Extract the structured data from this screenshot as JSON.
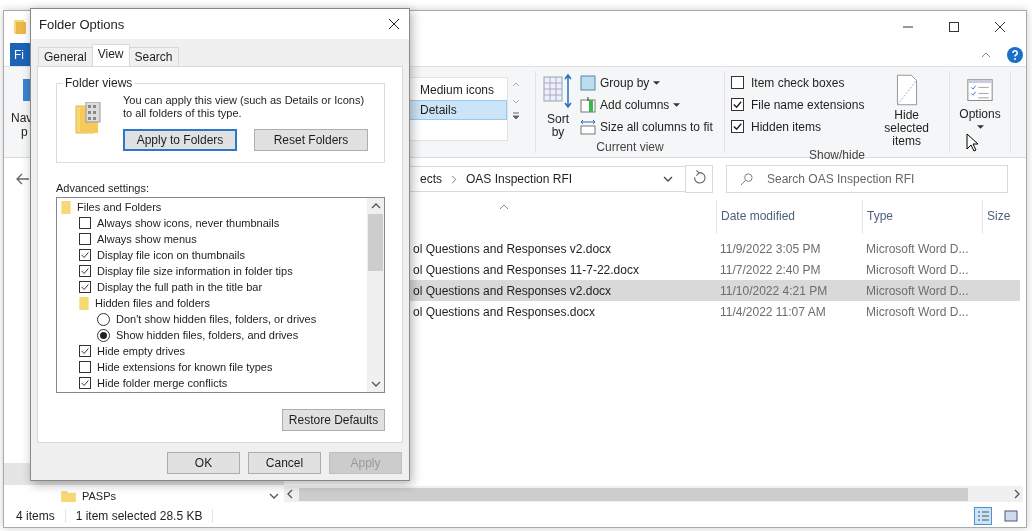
{
  "explorer": {
    "file_tab": "Fi",
    "nav_pane_button": [
      "Nav",
      "p"
    ],
    "layout_options": [
      {
        "label": "Medium icons",
        "selected": false
      },
      {
        "label": "Details",
        "selected": true
      }
    ],
    "current_view": {
      "sort_by": "Sort by",
      "group_by": "Group by",
      "add_columns": "Add columns",
      "size_columns": "Size all columns to fit",
      "group_label": "Current view"
    },
    "show_hide": {
      "checkboxes": [
        {
          "label": "Item check boxes",
          "checked": false
        },
        {
          "label": "File name extensions",
          "checked": true
        },
        {
          "label": "Hidden items",
          "checked": true
        }
      ],
      "hide_selected": "Hide selected items",
      "group_label": "Show/hide"
    },
    "options_button": "Options",
    "address": {
      "path_tail": "ects",
      "current": "OAS Inspection RFI"
    },
    "search": {
      "placeholder": "Search OAS Inspection RFI"
    },
    "columns": [
      "Date modified",
      "Type",
      "Size"
    ],
    "files": [
      {
        "name": "ol Questions and Responses v2.docx",
        "date": "11/9/2022 3:05 PM",
        "type": "Microsoft Word D...",
        "selected": false
      },
      {
        "name": "ol Questions and Responses 11-7-22.docx",
        "date": "11/7/2022 2:40 PM",
        "type": "Microsoft Word D...",
        "selected": false
      },
      {
        "name": "ol Questions and Responses v2.docx",
        "date": "11/10/2022 4:21 PM",
        "type": "Microsoft Word D...",
        "selected": true
      },
      {
        "name": "ol Questions and Responses.docx",
        "date": "11/4/2022 11:07 AM",
        "type": "Microsoft Word D...",
        "selected": false
      }
    ],
    "nav_folder": "PASPs",
    "status": {
      "count": "4 items",
      "selection": "1 item selected  28.5 KB"
    }
  },
  "dialog": {
    "title": "Folder Options",
    "tabs": [
      {
        "label": "General",
        "selected": false
      },
      {
        "label": "View",
        "selected": true
      },
      {
        "label": "Search",
        "selected": false
      }
    ],
    "folder_views": {
      "legend": "Folder views",
      "text": "You can apply this view (such as Details or Icons) to all folders of this type.",
      "apply": "Apply to Folders",
      "reset": "Reset Folders"
    },
    "advanced_label": "Advanced settings:",
    "advanced_settings": [
      {
        "kind": "folder",
        "label": "Files and Folders",
        "children": [
          {
            "kind": "checkbox",
            "label": "Always show icons, never thumbnails",
            "checked": false
          },
          {
            "kind": "checkbox",
            "label": "Always show menus",
            "checked": false
          },
          {
            "kind": "checkbox",
            "label": "Display file icon on thumbnails",
            "checked": true
          },
          {
            "kind": "checkbox",
            "label": "Display file size information in folder tips",
            "checked": true
          },
          {
            "kind": "checkbox",
            "label": "Display the full path in the title bar",
            "checked": true
          },
          {
            "kind": "folder",
            "label": "Hidden files and folders",
            "children": [
              {
                "kind": "radio",
                "label": "Don't show hidden files, folders, or drives",
                "selected": false
              },
              {
                "kind": "radio",
                "label": "Show hidden files, folders, and drives",
                "selected": true
              }
            ]
          },
          {
            "kind": "checkbox",
            "label": "Hide empty drives",
            "checked": true
          },
          {
            "kind": "checkbox",
            "label": "Hide extensions for known file types",
            "checked": false
          },
          {
            "kind": "checkbox",
            "label": "Hide folder merge conflicts",
            "checked": true
          }
        ]
      }
    ],
    "restore": "Restore Defaults",
    "buttons": [
      {
        "label": "OK",
        "disabled": false
      },
      {
        "label": "Cancel",
        "disabled": false
      },
      {
        "label": "Apply",
        "disabled": true
      }
    ]
  }
}
